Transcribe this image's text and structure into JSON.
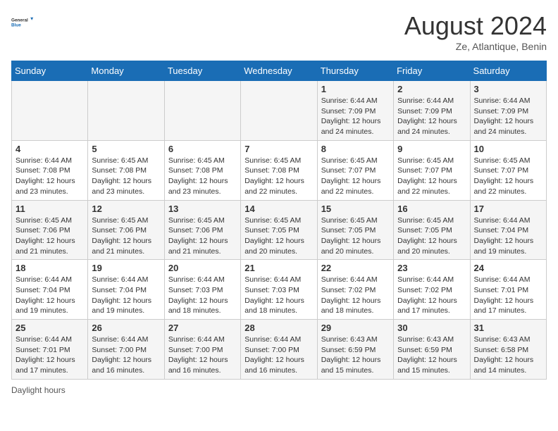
{
  "header": {
    "logo_general": "General",
    "logo_blue": "Blue",
    "month_year": "August 2024",
    "location": "Ze, Atlantique, Benin"
  },
  "days_of_week": [
    "Sunday",
    "Monday",
    "Tuesday",
    "Wednesday",
    "Thursday",
    "Friday",
    "Saturday"
  ],
  "weeks": [
    [
      {
        "day": "",
        "info": ""
      },
      {
        "day": "",
        "info": ""
      },
      {
        "day": "",
        "info": ""
      },
      {
        "day": "",
        "info": ""
      },
      {
        "day": "1",
        "info": "Sunrise: 6:44 AM\nSunset: 7:09 PM\nDaylight: 12 hours and 24 minutes."
      },
      {
        "day": "2",
        "info": "Sunrise: 6:44 AM\nSunset: 7:09 PM\nDaylight: 12 hours and 24 minutes."
      },
      {
        "day": "3",
        "info": "Sunrise: 6:44 AM\nSunset: 7:09 PM\nDaylight: 12 hours and 24 minutes."
      }
    ],
    [
      {
        "day": "4",
        "info": "Sunrise: 6:44 AM\nSunset: 7:08 PM\nDaylight: 12 hours and 23 minutes."
      },
      {
        "day": "5",
        "info": "Sunrise: 6:45 AM\nSunset: 7:08 PM\nDaylight: 12 hours and 23 minutes."
      },
      {
        "day": "6",
        "info": "Sunrise: 6:45 AM\nSunset: 7:08 PM\nDaylight: 12 hours and 23 minutes."
      },
      {
        "day": "7",
        "info": "Sunrise: 6:45 AM\nSunset: 7:08 PM\nDaylight: 12 hours and 22 minutes."
      },
      {
        "day": "8",
        "info": "Sunrise: 6:45 AM\nSunset: 7:07 PM\nDaylight: 12 hours and 22 minutes."
      },
      {
        "day": "9",
        "info": "Sunrise: 6:45 AM\nSunset: 7:07 PM\nDaylight: 12 hours and 22 minutes."
      },
      {
        "day": "10",
        "info": "Sunrise: 6:45 AM\nSunset: 7:07 PM\nDaylight: 12 hours and 22 minutes."
      }
    ],
    [
      {
        "day": "11",
        "info": "Sunrise: 6:45 AM\nSunset: 7:06 PM\nDaylight: 12 hours and 21 minutes."
      },
      {
        "day": "12",
        "info": "Sunrise: 6:45 AM\nSunset: 7:06 PM\nDaylight: 12 hours and 21 minutes."
      },
      {
        "day": "13",
        "info": "Sunrise: 6:45 AM\nSunset: 7:06 PM\nDaylight: 12 hours and 21 minutes."
      },
      {
        "day": "14",
        "info": "Sunrise: 6:45 AM\nSunset: 7:05 PM\nDaylight: 12 hours and 20 minutes."
      },
      {
        "day": "15",
        "info": "Sunrise: 6:45 AM\nSunset: 7:05 PM\nDaylight: 12 hours and 20 minutes."
      },
      {
        "day": "16",
        "info": "Sunrise: 6:45 AM\nSunset: 7:05 PM\nDaylight: 12 hours and 20 minutes."
      },
      {
        "day": "17",
        "info": "Sunrise: 6:44 AM\nSunset: 7:04 PM\nDaylight: 12 hours and 19 minutes."
      }
    ],
    [
      {
        "day": "18",
        "info": "Sunrise: 6:44 AM\nSunset: 7:04 PM\nDaylight: 12 hours and 19 minutes."
      },
      {
        "day": "19",
        "info": "Sunrise: 6:44 AM\nSunset: 7:04 PM\nDaylight: 12 hours and 19 minutes."
      },
      {
        "day": "20",
        "info": "Sunrise: 6:44 AM\nSunset: 7:03 PM\nDaylight: 12 hours and 18 minutes."
      },
      {
        "day": "21",
        "info": "Sunrise: 6:44 AM\nSunset: 7:03 PM\nDaylight: 12 hours and 18 minutes."
      },
      {
        "day": "22",
        "info": "Sunrise: 6:44 AM\nSunset: 7:02 PM\nDaylight: 12 hours and 18 minutes."
      },
      {
        "day": "23",
        "info": "Sunrise: 6:44 AM\nSunset: 7:02 PM\nDaylight: 12 hours and 17 minutes."
      },
      {
        "day": "24",
        "info": "Sunrise: 6:44 AM\nSunset: 7:01 PM\nDaylight: 12 hours and 17 minutes."
      }
    ],
    [
      {
        "day": "25",
        "info": "Sunrise: 6:44 AM\nSunset: 7:01 PM\nDaylight: 12 hours and 17 minutes."
      },
      {
        "day": "26",
        "info": "Sunrise: 6:44 AM\nSunset: 7:00 PM\nDaylight: 12 hours and 16 minutes."
      },
      {
        "day": "27",
        "info": "Sunrise: 6:44 AM\nSunset: 7:00 PM\nDaylight: 12 hours and 16 minutes."
      },
      {
        "day": "28",
        "info": "Sunrise: 6:44 AM\nSunset: 7:00 PM\nDaylight: 12 hours and 16 minutes."
      },
      {
        "day": "29",
        "info": "Sunrise: 6:43 AM\nSunset: 6:59 PM\nDaylight: 12 hours and 15 minutes."
      },
      {
        "day": "30",
        "info": "Sunrise: 6:43 AM\nSunset: 6:59 PM\nDaylight: 12 hours and 15 minutes."
      },
      {
        "day": "31",
        "info": "Sunrise: 6:43 AM\nSunset: 6:58 PM\nDaylight: 12 hours and 14 minutes."
      }
    ]
  ],
  "footer": {
    "daylight_hours": "Daylight hours"
  }
}
